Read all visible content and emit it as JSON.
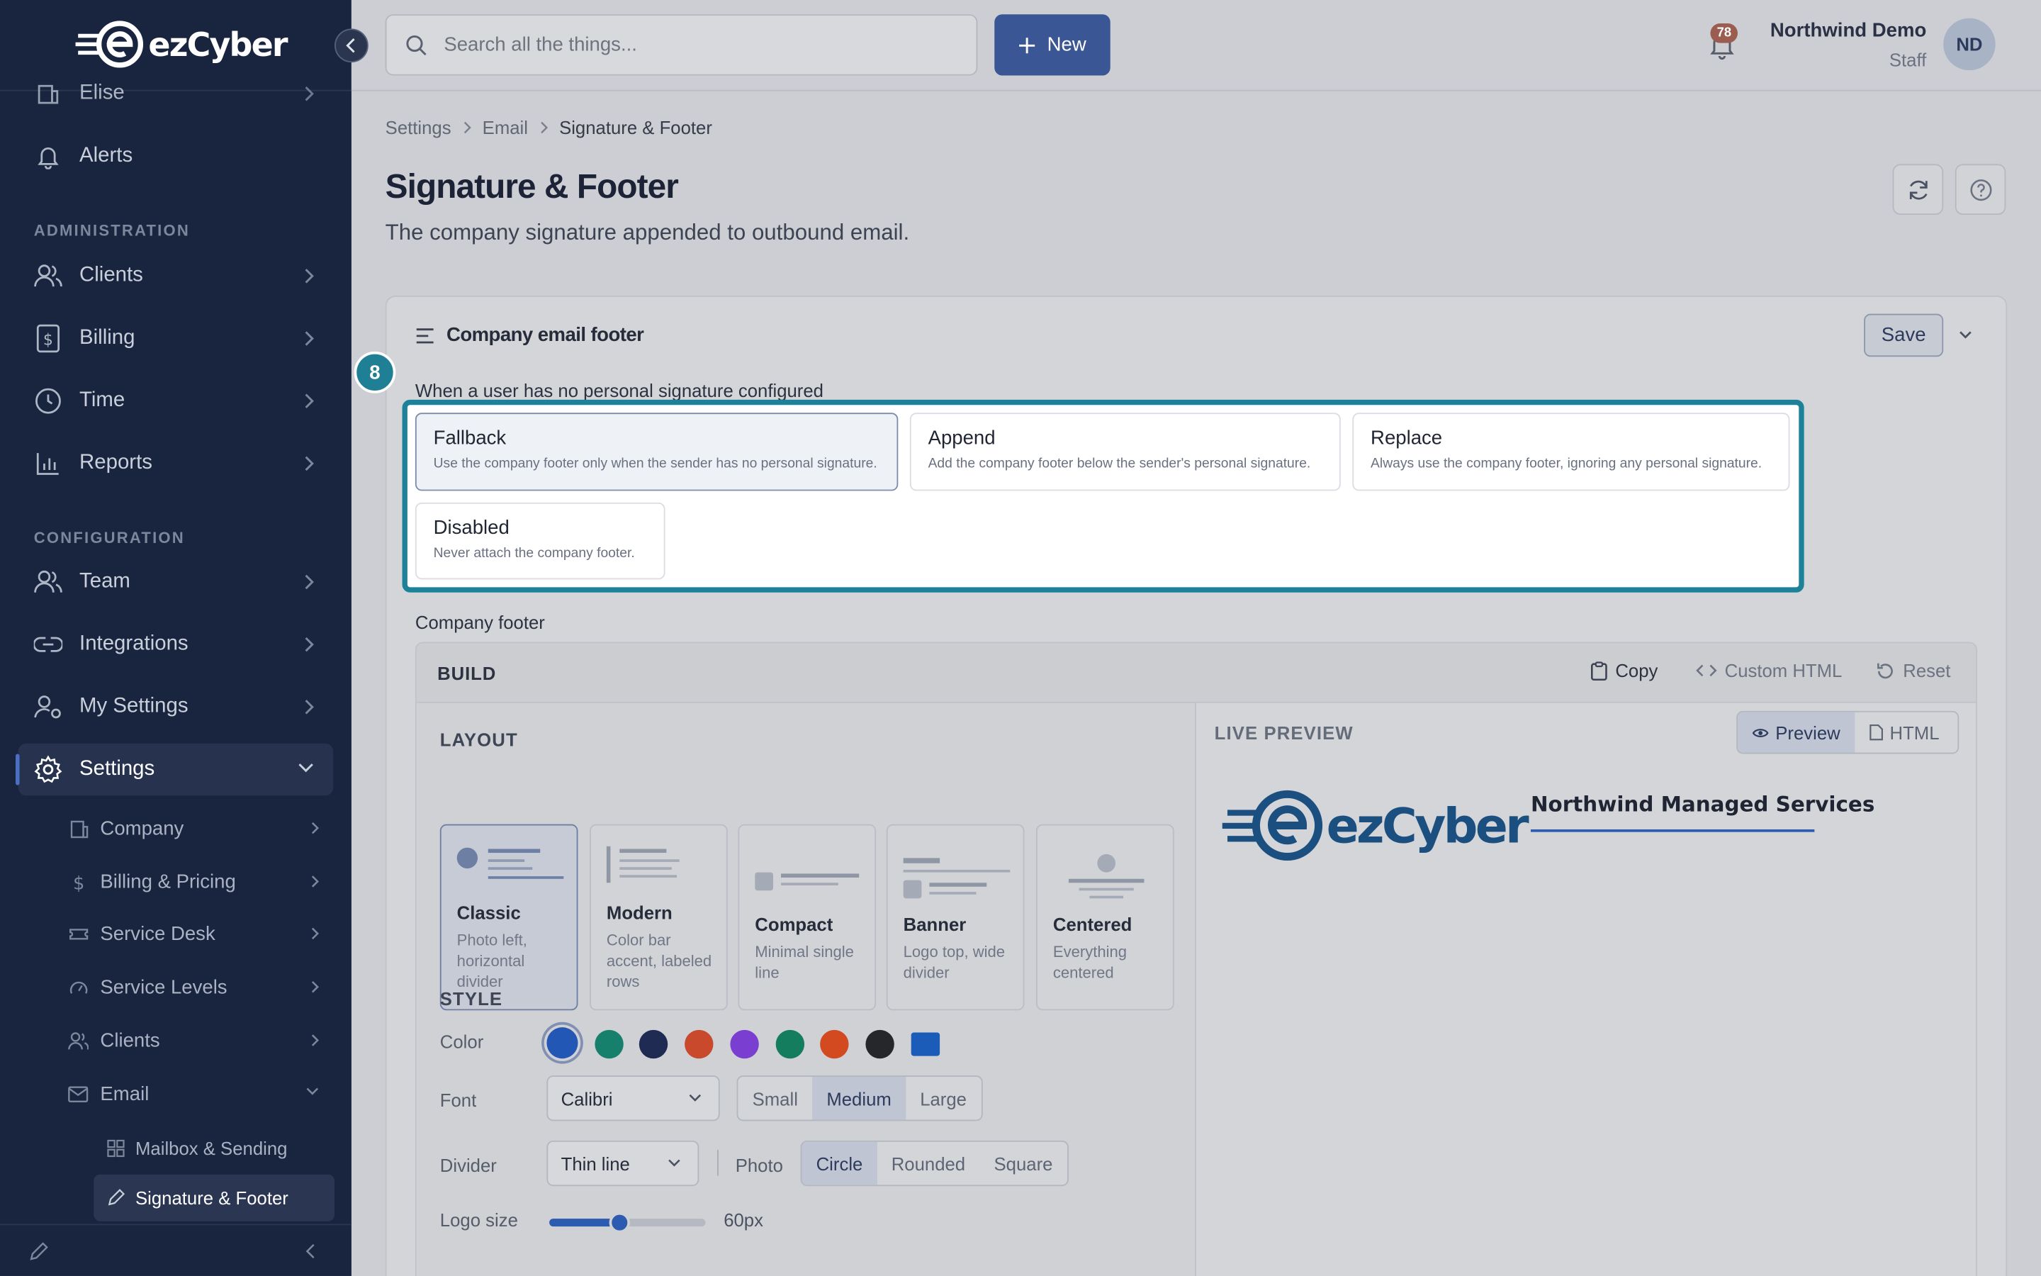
{
  "app": {
    "logo_text": "ezCyber"
  },
  "search": {
    "placeholder": "Search all the things..."
  },
  "topbar": {
    "new_label": "New",
    "notif_count": "78",
    "user_name": "Northwind Demo",
    "user_role": "Staff",
    "avatar": "ND"
  },
  "sidebar": {
    "top_items": [
      {
        "label": "Elise",
        "icon": "building-icon"
      },
      {
        "label": "Alerts",
        "icon": "bell-icon"
      }
    ],
    "admin_heading": "ADMINISTRATION",
    "admin_items": [
      {
        "label": "Clients"
      },
      {
        "label": "Billing"
      },
      {
        "label": "Time"
      },
      {
        "label": "Reports"
      }
    ],
    "config_heading": "CONFIGURATION",
    "config_items": [
      {
        "label": "Team"
      },
      {
        "label": "Integrations"
      },
      {
        "label": "My Settings"
      },
      {
        "label": "Settings"
      }
    ],
    "settings_sub": [
      {
        "label": "Company"
      },
      {
        "label": "Billing & Pricing"
      },
      {
        "label": "Service Desk"
      },
      {
        "label": "Service Levels"
      },
      {
        "label": "Clients"
      },
      {
        "label": "Email"
      }
    ],
    "email_sub": [
      {
        "label": "Mailbox & Sending"
      },
      {
        "label": "Signature & Footer"
      }
    ]
  },
  "breadcrumb": [
    "Settings",
    "Email",
    "Signature & Footer"
  ],
  "page": {
    "title": "Signature & Footer",
    "subtitle": "The company signature appended to outbound email."
  },
  "card": {
    "title": "Company email footer",
    "save_label": "Save",
    "step_number": "8"
  },
  "mode": {
    "question": "When a user has no personal signature configured",
    "options": [
      {
        "title": "Fallback",
        "desc": "Use the company footer only when the sender has no personal signature.",
        "selected": true
      },
      {
        "title": "Append",
        "desc": "Add the company footer below the sender's personal signature.",
        "selected": false
      },
      {
        "title": "Replace",
        "desc": "Always use the company footer, ignoring any personal signature.",
        "selected": false
      },
      {
        "title": "Disabled",
        "desc": "Never attach the company footer.",
        "selected": false
      }
    ]
  },
  "footer_section": {
    "label": "Company footer"
  },
  "builder": {
    "title": "BUILD",
    "copy": "Copy",
    "custom_html": "Custom HTML",
    "reset": "Reset",
    "layout_heading": "LAYOUT",
    "layouts": [
      {
        "name": "Classic",
        "desc": "Photo left, horizontal divider",
        "selected": true
      },
      {
        "name": "Modern",
        "desc": "Color bar accent, labeled rows",
        "selected": false
      },
      {
        "name": "Compact",
        "desc": "Minimal single line",
        "selected": false
      },
      {
        "name": "Banner",
        "desc": "Logo top, wide divider",
        "selected": false
      },
      {
        "name": "Centered",
        "desc": "Everything centered",
        "selected": false
      }
    ],
    "style_heading": "STYLE",
    "color_label": "Color",
    "colors": [
      "#2257b5",
      "#17806d",
      "#1f2b52",
      "#c8492b",
      "#7a3fd1",
      "#147d5e",
      "#d44a20",
      "#25272b",
      "#1a5cb8"
    ],
    "font_label": "Font",
    "font_value": "Calibri",
    "sizes": [
      "Small",
      "Medium",
      "Large"
    ],
    "size_selected": "Medium",
    "divider_label": "Divider",
    "divider_value": "Thin line",
    "photo_label": "Photo",
    "photo_shapes": [
      "Circle",
      "Rounded",
      "Square"
    ],
    "photo_selected": "Circle",
    "logo_size_label": "Logo size",
    "logo_size_value": "60px",
    "logo_size_fraction": 0.45
  },
  "preview": {
    "heading": "LIVE PREVIEW",
    "preview_tab": "Preview",
    "html_tab": "HTML",
    "company": "Northwind Managed Services",
    "logo_text": "ezCyber"
  }
}
